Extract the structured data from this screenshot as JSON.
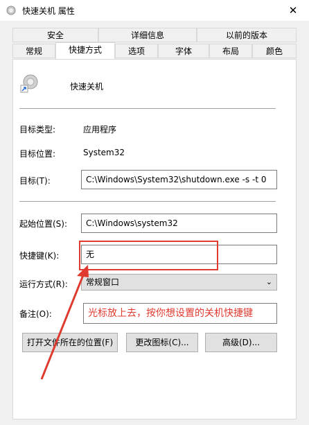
{
  "window": {
    "title": "快速关机 属性",
    "close_glyph": "✕"
  },
  "tabs_row1": [
    "安全",
    "详细信息",
    "以前的版本"
  ],
  "tabs_row2": [
    "常规",
    "快捷方式",
    "选项",
    "字体",
    "布局",
    "颜色"
  ],
  "active_tab": "快捷方式",
  "shortcut": {
    "name": "快速关机",
    "icon": "shutdown-shortcut-icon"
  },
  "fields": {
    "target_type_label": "目标类型:",
    "target_type_value": "应用程序",
    "target_location_label": "目标位置:",
    "target_location_value": "System32",
    "target_label": "目标(T):",
    "target_value": "C:\\Windows\\System32\\shutdown.exe -s -t 0",
    "start_in_label": "起始位置(S):",
    "start_in_value": "C:\\Windows\\system32",
    "hotkey_label": "快捷键(K):",
    "hotkey_value": "无",
    "run_label": "运行方式(R):",
    "run_value": "常规窗口",
    "comment_label": "备注(O):"
  },
  "buttons": {
    "open_location": "打开文件所在的位置(F)",
    "change_icon": "更改图标(C)...",
    "advanced": "高级(D)..."
  },
  "annotation": {
    "text": "光标放上去，按你想设置的关机快捷键",
    "color": "#e03a2f"
  }
}
